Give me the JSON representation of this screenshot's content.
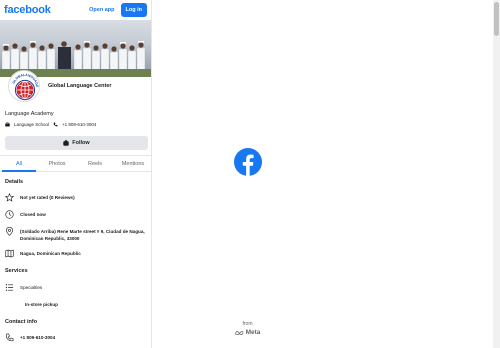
{
  "header": {
    "brand": "facebook",
    "open_app_label": "Open app",
    "login_label": "Log in"
  },
  "profile": {
    "name": "Global Language Center",
    "avatar_text": "GLOBALANGUAGE",
    "category": "Language Academy",
    "type": "Language School",
    "phone": "+1 809-610-3004",
    "follow_label": "Follow"
  },
  "tabs": [
    {
      "label": "All",
      "active": true
    },
    {
      "label": "Photos",
      "active": false
    },
    {
      "label": "Reels",
      "active": false
    },
    {
      "label": "Mentions",
      "active": false
    }
  ],
  "details": {
    "title": "Details",
    "rating": "Not yet rated (0 Reviews)",
    "hours": "Closed now",
    "address": "(Soldado Arriba) Rene Marte street # 9, Ciudad de Nagua, Dominican Republic, 33000",
    "city": "Nagua, Dominican Republic"
  },
  "services": {
    "title": "Services",
    "specialties": "Specialties",
    "pickup": "In-store pickup"
  },
  "contact": {
    "title": "Contact info",
    "phone": "+1 809-610-3004"
  },
  "footer": {
    "from": "from",
    "meta": "Meta"
  },
  "colors": {
    "brand": "#1877f2",
    "text": "#1c1e21",
    "muted": "#65676b",
    "button_bg": "#e4e6eb"
  }
}
